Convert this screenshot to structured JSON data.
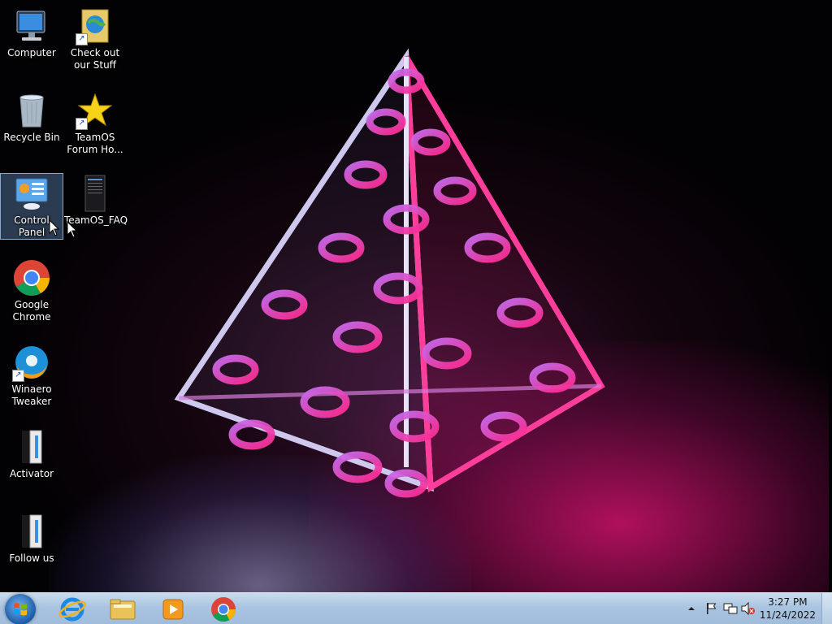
{
  "desktop_icons": [
    {
      "label": "Computer",
      "icon": "computer-icon",
      "shortcut": false
    },
    {
      "label": "Check out our Stuff",
      "icon": "globe-book-icon",
      "shortcut": true
    },
    {
      "label": "Recycle Bin",
      "icon": "recycle-bin-icon",
      "shortcut": false
    },
    {
      "label": "TeamOS Forum Ho...",
      "icon": "star-icon",
      "shortcut": true
    },
    {
      "label": "Control Panel",
      "icon": "control-panel-icon",
      "shortcut": false,
      "selected": true
    },
    {
      "label": "TeamOS_FAQ",
      "icon": "document-icon",
      "shortcut": false
    },
    {
      "label": "Google Chrome",
      "icon": "chrome-icon",
      "shortcut": false
    },
    {
      "label": "Winaero Tweaker",
      "icon": "winaero-tweaker-icon",
      "shortcut": true
    },
    {
      "label": "Activator",
      "icon": "activator-icon",
      "shortcut": false
    },
    {
      "label": "Follow us",
      "icon": "follow-us-icon",
      "shortcut": false
    }
  ],
  "taskbar": {
    "start": "start-orb-icon",
    "pinned": [
      "internet-explorer-icon",
      "file-explorer-icon",
      "media-player-icon",
      "chrome-icon"
    ],
    "tray_icons": [
      "show-hidden-icons-arrow",
      "action-center-flag-icon",
      "network-icon",
      "volume-muted-icon"
    ],
    "time": "3:27 PM",
    "date": "11/24/2022"
  },
  "colors": {
    "accent_pink": "#e0177a",
    "accent_purple": "#8a2be2",
    "taskbar": "#a9c4e0"
  }
}
